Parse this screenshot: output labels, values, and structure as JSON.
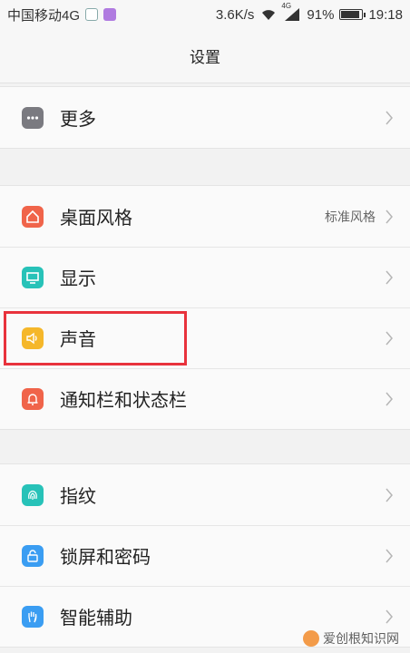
{
  "status_bar": {
    "carrier": "中国移动4G",
    "speed": "3.6K/s",
    "network_badge": "4G",
    "battery_pct": "91%",
    "battery_level": 0.91,
    "time": "19:18"
  },
  "header": {
    "title": "设置"
  },
  "groups": [
    {
      "items": [
        {
          "label": "更多",
          "icon": "more-icon",
          "color": "#7a7a80"
        }
      ]
    },
    {
      "items": [
        {
          "label": "桌面风格",
          "value": "标准风格",
          "icon": "home-icon",
          "color": "#f0644a"
        },
        {
          "label": "显示",
          "icon": "display-icon",
          "color": "#27c2b8"
        },
        {
          "label": "声音",
          "icon": "speaker-icon",
          "color": "#f5b72a"
        },
        {
          "label": "通知栏和状态栏",
          "icon": "bell-icon",
          "color": "#f0644a"
        }
      ]
    },
    {
      "items": [
        {
          "label": "指纹",
          "icon": "fingerprint-icon",
          "color": "#27c2b8"
        },
        {
          "label": "锁屏和密码",
          "icon": "lock-icon",
          "color": "#3a9df2"
        },
        {
          "label": "智能辅助",
          "icon": "hand-icon",
          "color": "#3a9df2"
        }
      ]
    }
  ],
  "watermark": {
    "text": "爱创根知识网"
  }
}
